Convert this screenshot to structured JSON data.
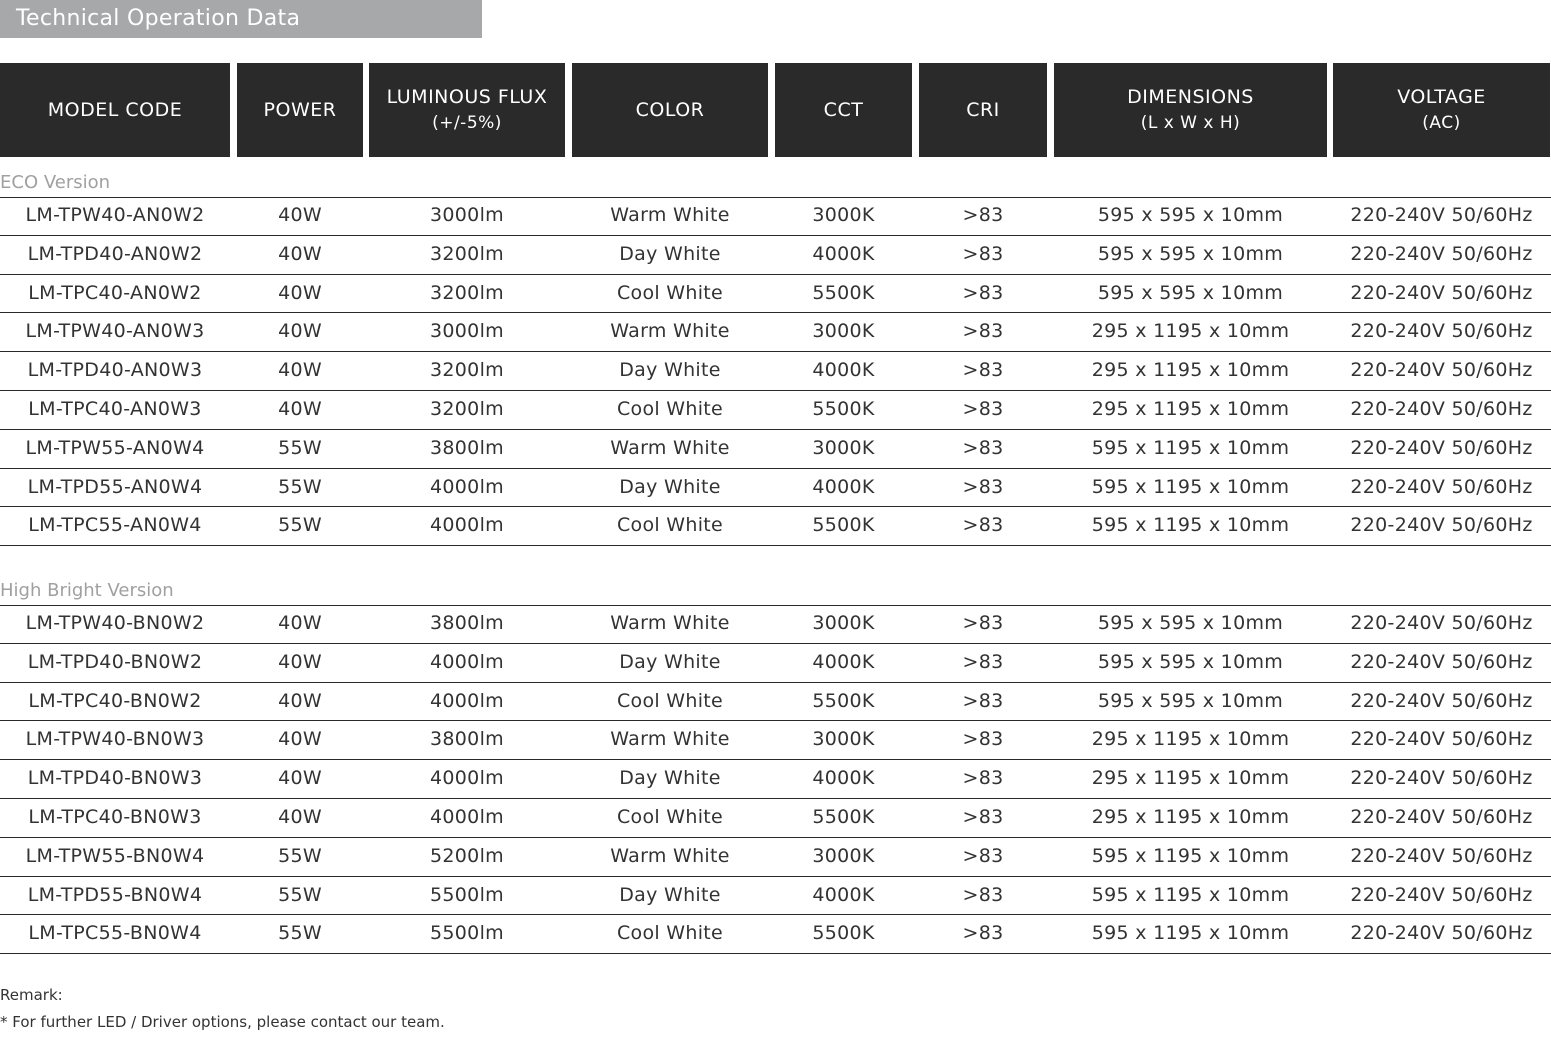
{
  "title": "Technical Operation Data",
  "headers": [
    {
      "line1": "MODEL CODE",
      "line2": ""
    },
    {
      "line1": "POWER",
      "line2": ""
    },
    {
      "line1": "LUMINOUS FLUX",
      "line2": "(+/-5%)"
    },
    {
      "line1": "COLOR",
      "line2": ""
    },
    {
      "line1": "CCT",
      "line2": ""
    },
    {
      "line1": "CRI",
      "line2": ""
    },
    {
      "line1": "DIMENSIONS",
      "line2": "(L x W x H)"
    },
    {
      "line1": "VOLTAGE",
      "line2": "(AC)"
    }
  ],
  "sections": [
    {
      "label": "ECO Version",
      "rows": [
        [
          "LM-TPW40-AN0W2",
          "40W",
          "3000lm",
          "Warm White",
          "3000K",
          ">83",
          "595 x 595 x 10mm",
          "220-240V 50/60Hz"
        ],
        [
          "LM-TPD40-AN0W2",
          "40W",
          "3200lm",
          "Day White",
          "4000K",
          ">83",
          "595 x 595 x 10mm",
          "220-240V 50/60Hz"
        ],
        [
          "LM-TPC40-AN0W2",
          "40W",
          "3200lm",
          "Cool White",
          "5500K",
          ">83",
          "595 x 595 x 10mm",
          "220-240V 50/60Hz"
        ],
        [
          "LM-TPW40-AN0W3",
          "40W",
          "3000lm",
          "Warm White",
          "3000K",
          ">83",
          "295 x 1195 x 10mm",
          "220-240V 50/60Hz"
        ],
        [
          "LM-TPD40-AN0W3",
          "40W",
          "3200lm",
          "Day White",
          "4000K",
          ">83",
          "295 x 1195 x 10mm",
          "220-240V 50/60Hz"
        ],
        [
          "LM-TPC40-AN0W3",
          "40W",
          "3200lm",
          "Cool White",
          "5500K",
          ">83",
          "295 x 1195 x 10mm",
          "220-240V 50/60Hz"
        ],
        [
          "LM-TPW55-AN0W4",
          "55W",
          "3800lm",
          "Warm White",
          "3000K",
          ">83",
          "595 x 1195 x 10mm",
          "220-240V 50/60Hz"
        ],
        [
          "LM-TPD55-AN0W4",
          "55W",
          "4000lm",
          "Day White",
          "4000K",
          ">83",
          "595 x 1195 x 10mm",
          "220-240V 50/60Hz"
        ],
        [
          "LM-TPC55-AN0W4",
          "55W",
          "4000lm",
          "Cool White",
          "5500K",
          ">83",
          "595 x 1195 x 10mm",
          "220-240V 50/60Hz"
        ]
      ]
    },
    {
      "label": "High Bright Version",
      "rows": [
        [
          "LM-TPW40-BN0W2",
          "40W",
          "3800lm",
          "Warm White",
          "3000K",
          ">83",
          "595 x 595 x 10mm",
          "220-240V 50/60Hz"
        ],
        [
          "LM-TPD40-BN0W2",
          "40W",
          "4000lm",
          "Day White",
          "4000K",
          ">83",
          "595 x 595 x 10mm",
          "220-240V 50/60Hz"
        ],
        [
          "LM-TPC40-BN0W2",
          "40W",
          "4000lm",
          "Cool White",
          "5500K",
          ">83",
          "595 x 595 x 10mm",
          "220-240V 50/60Hz"
        ],
        [
          "LM-TPW40-BN0W3",
          "40W",
          "3800lm",
          "Warm White",
          "3000K",
          ">83",
          "295 x 1195 x 10mm",
          "220-240V 50/60Hz"
        ],
        [
          "LM-TPD40-BN0W3",
          "40W",
          "4000lm",
          "Day White",
          "4000K",
          ">83",
          "295 x 1195 x 10mm",
          "220-240V 50/60Hz"
        ],
        [
          "LM-TPC40-BN0W3",
          "40W",
          "4000lm",
          "Cool White",
          "5500K",
          ">83",
          "295 x 1195 x 10mm",
          "220-240V 50/60Hz"
        ],
        [
          "LM-TPW55-BN0W4",
          "55W",
          "5200lm",
          "Warm White",
          "3000K",
          ">83",
          "595 x 1195 x 10mm",
          "220-240V 50/60Hz"
        ],
        [
          "LM-TPD55-BN0W4",
          "55W",
          "5500lm",
          "Day White",
          "4000K",
          ">83",
          "595 x 1195 x 10mm",
          "220-240V 50/60Hz"
        ],
        [
          "LM-TPC55-BN0W4",
          "55W",
          "5500lm",
          "Cool White",
          "5500K",
          ">83",
          "595 x 1195 x 10mm",
          "220-240V 50/60Hz"
        ]
      ]
    }
  ],
  "remark": {
    "label": "Remark:",
    "note": "* For further LED / Driver options, please contact our team."
  },
  "colors": {
    "header_bg": "#2a2a2a",
    "title_bg": "#a7a8aa",
    "section_label": "#a0a0a0"
  }
}
